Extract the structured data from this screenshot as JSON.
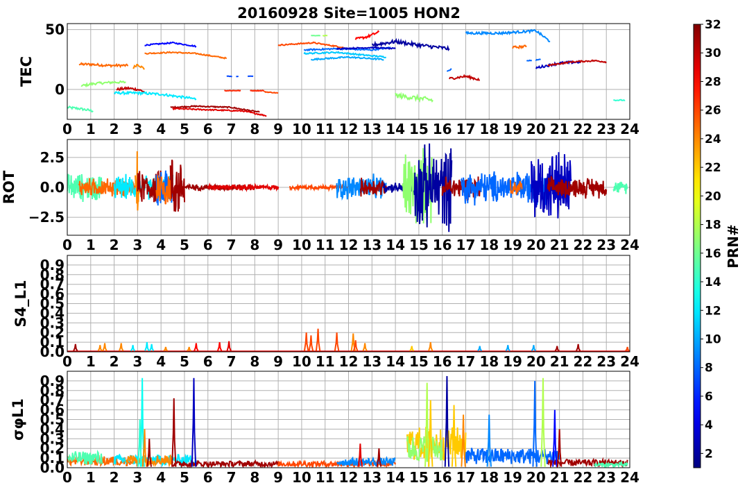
{
  "title": "20160928 Site=1005 HON2",
  "colorbar": {
    "label": "PRN#",
    "ticks": [
      "2",
      "4",
      "6",
      "8",
      "10",
      "12",
      "14",
      "16",
      "18",
      "20",
      "22",
      "24",
      "26",
      "28",
      "30",
      "32"
    ],
    "range": [
      1,
      32
    ],
    "colormap": "jet"
  },
  "chart_data": [
    {
      "type": "line",
      "panel": "tec",
      "ylabel": "TEC",
      "xlim": [
        0,
        24
      ],
      "ylim": [
        -25,
        55
      ],
      "xticks": [
        "0",
        "1",
        "2",
        "3",
        "4",
        "5",
        "6",
        "7",
        "8",
        "9",
        "10",
        "11",
        "12",
        "13",
        "14",
        "15",
        "16",
        "17",
        "18",
        "19",
        "20",
        "21",
        "22",
        "23",
        "24"
      ],
      "yticks": [
        "50",
        "0"
      ],
      "yticks_values": [
        50,
        0
      ],
      "grid": true,
      "series": [
        {
          "prn": 15,
          "x": [
            0.0,
            0.5,
            1.1
          ],
          "y": [
            -15,
            -16,
            -18
          ],
          "noise": 1
        },
        {
          "prn": 25,
          "x": [
            0.5,
            1.0,
            1.7,
            2.6
          ],
          "y": [
            21,
            21,
            20,
            20
          ],
          "noise": 1
        },
        {
          "prn": 17,
          "x": [
            0.6,
            1.2,
            2.0,
            2.5
          ],
          "y": [
            3,
            5,
            6,
            6
          ],
          "noise": 1
        },
        {
          "prn": 24,
          "x": [
            2.8,
            3.0,
            3.3
          ],
          "y": [
            18,
            21,
            17
          ],
          "noise": 1
        },
        {
          "prn": 30,
          "x": [
            2.1,
            2.6,
            3.0,
            3.3
          ],
          "y": [
            0,
            1,
            0,
            -2
          ],
          "noise": 1
        },
        {
          "prn": 12,
          "x": [
            2.0,
            3.0,
            4.0,
            5.5
          ],
          "y": [
            -3,
            -3,
            -4,
            -8
          ],
          "noise": 1
        },
        {
          "prn": 5,
          "x": [
            3.3,
            4.5,
            5.5
          ],
          "y": [
            37,
            39,
            36
          ],
          "noise": 0.5
        },
        {
          "prn": 25,
          "x": [
            3.3,
            4.5,
            5.5,
            6.8
          ],
          "y": [
            30,
            31,
            30,
            26
          ],
          "noise": 0.5
        },
        {
          "prn": 31,
          "x": [
            4.4,
            5.5,
            7.0,
            8.2
          ],
          "y": [
            -15,
            -14,
            -15,
            -19
          ],
          "noise": 0.5
        },
        {
          "prn": 29,
          "x": [
            4.5,
            6.0,
            7.5,
            8.5
          ],
          "y": [
            -16,
            -17,
            -18,
            -22
          ],
          "noise": 0.5
        },
        {
          "prn": 27,
          "x": [
            6.7,
            7.4
          ],
          "y": [
            -1,
            -1
          ],
          "noise": 0.3
        },
        {
          "prn": 27,
          "x": [
            7.8,
            8.4
          ],
          "y": [
            -1,
            -1
          ],
          "noise": 0.3
        },
        {
          "prn": 26,
          "x": [
            8.4,
            9.0
          ],
          "y": [
            -2,
            -3
          ],
          "noise": 0.3
        },
        {
          "prn": 7,
          "x": [
            6.8,
            7.3
          ],
          "y": [
            11,
            11
          ],
          "noise": 0.2,
          "dash": true
        },
        {
          "prn": 7,
          "x": [
            7.7,
            8.0
          ],
          "y": [
            11,
            11
          ],
          "noise": 0.2,
          "dash": true
        },
        {
          "prn": 26,
          "x": [
            9.0,
            10.5,
            11.8
          ],
          "y": [
            37,
            39,
            35
          ],
          "noise": 0.5
        },
        {
          "prn": 16,
          "x": [
            10.4,
            10.8
          ],
          "y": [
            45,
            45
          ],
          "noise": 0.2
        },
        {
          "prn": 18,
          "x": [
            10.9,
            11.1
          ],
          "y": [
            45,
            45
          ],
          "noise": 0.2
        },
        {
          "prn": 28,
          "x": [
            12.3,
            12.8,
            13.3
          ],
          "y": [
            42,
            44,
            48
          ],
          "noise": 1
        },
        {
          "prn": 8,
          "x": [
            10.1,
            11.5,
            13.0,
            13.8
          ],
          "y": [
            33,
            34,
            33,
            35
          ],
          "noise": 0.6
        },
        {
          "prn": 10,
          "x": [
            10.4,
            12.0,
            13.5
          ],
          "y": [
            25,
            27,
            25
          ],
          "noise": 0.6
        },
        {
          "prn": 11,
          "x": [
            10.1,
            11.5,
            12.5,
            13.6
          ],
          "y": [
            30,
            31,
            29,
            27
          ],
          "noise": 0.6
        },
        {
          "prn": 3,
          "x": [
            11.5,
            13.0,
            14.0
          ],
          "y": [
            34,
            35,
            34
          ],
          "noise": 0.5
        },
        {
          "prn": 2,
          "x": [
            13.0,
            14.0,
            15.0,
            16.3
          ],
          "y": [
            37,
            40,
            37,
            34
          ],
          "noise": 1.5
        },
        {
          "prn": 17,
          "x": [
            14.0,
            14.8,
            15.6
          ],
          "y": [
            -5,
            -7,
            -9
          ],
          "noise": 2
        },
        {
          "prn": 8,
          "x": [
            16.2,
            16.4
          ],
          "y": [
            15,
            17
          ],
          "noise": 0.5
        },
        {
          "prn": 30,
          "x": [
            16.3,
            17.0,
            17.6
          ],
          "y": [
            9,
            11,
            8
          ],
          "noise": 1
        },
        {
          "prn": 9,
          "x": [
            17.0,
            18.5,
            20.0,
            20.6
          ],
          "y": [
            47,
            47,
            49,
            40
          ],
          "noise": 1
        },
        {
          "prn": 25,
          "x": [
            19.0,
            19.6
          ],
          "y": [
            35,
            36
          ],
          "noise": 1
        },
        {
          "prn": 8,
          "x": [
            19.6,
            20.2
          ],
          "y": [
            24,
            25
          ],
          "noise": 0.3,
          "dash": true
        },
        {
          "prn": 3,
          "x": [
            20.0,
            21.0,
            21.9
          ],
          "y": [
            18,
            22,
            23
          ],
          "noise": 1
        },
        {
          "prn": 30,
          "x": [
            20.5,
            21.5,
            22.5,
            23.0
          ],
          "y": [
            20,
            23,
            24,
            23
          ],
          "noise": 0.6
        },
        {
          "prn": 14,
          "x": [
            23.3,
            23.8
          ],
          "y": [
            -9,
            -9
          ],
          "noise": 0.4
        }
      ]
    },
    {
      "type": "line",
      "panel": "rot",
      "ylabel": "ROT",
      "xlim": [
        0,
        24
      ],
      "ylim": [
        -4,
        4
      ],
      "xticks": [
        "0",
        "1",
        "2",
        "3",
        "4",
        "5",
        "6",
        "7",
        "8",
        "9",
        "10",
        "11",
        "12",
        "13",
        "14",
        "15",
        "16",
        "17",
        "18",
        "19",
        "20",
        "21",
        "22",
        "23",
        "24"
      ],
      "yticks": [
        "2.5",
        "0.0",
        "−2.5"
      ],
      "yticks_values": [
        2.5,
        0,
        -2.5
      ],
      "grid": true,
      "series": [
        {
          "prn": 15,
          "x": [
            0.0,
            1.5
          ],
          "amp": 1.4
        },
        {
          "prn": 25,
          "x": [
            0.5,
            3.0
          ],
          "amp": 0.9
        },
        {
          "prn": 12,
          "x": [
            2.0,
            4.5
          ],
          "amp": 1.2
        },
        {
          "prn": 24,
          "x": [
            2.9,
            3.1
          ],
          "amp": 3.5
        },
        {
          "prn": 31,
          "x": [
            3.0,
            4.0
          ],
          "amp": 1.6
        },
        {
          "prn": 8,
          "x": [
            3.8,
            4.5
          ],
          "amp": 2.2
        },
        {
          "prn": 25,
          "x": [
            3.8,
            4.4
          ],
          "amp": 2.0
        },
        {
          "prn": 31,
          "x": [
            4.4,
            5.0
          ],
          "amp": 3.2
        },
        {
          "prn": 31,
          "x": [
            5.0,
            8.0
          ],
          "amp": 0.3
        },
        {
          "prn": 29,
          "x": [
            6.0,
            9.0
          ],
          "amp": 0.25
        },
        {
          "prn": 26,
          "x": [
            9.5,
            12.0
          ],
          "amp": 0.2
        },
        {
          "prn": 9,
          "x": [
            11.5,
            13.6
          ],
          "amp": 1.2
        },
        {
          "prn": 31,
          "x": [
            12.5,
            13.6
          ],
          "amp": 0.9
        },
        {
          "prn": 2,
          "x": [
            13.5,
            15.0
          ],
          "amp": 0.5
        },
        {
          "prn": 17,
          "x": [
            14.3,
            15.6
          ],
          "amp": 3.8
        },
        {
          "prn": 2,
          "x": [
            14.8,
            16.4
          ],
          "amp": 4.0
        },
        {
          "prn": 31,
          "x": [
            16.0,
            17.6
          ],
          "amp": 1.2
        },
        {
          "prn": 8,
          "x": [
            16.8,
            20.5
          ],
          "amp": 1.6
        },
        {
          "prn": 25,
          "x": [
            18.9,
            19.4
          ],
          "amp": 0.8
        },
        {
          "prn": 3,
          "x": [
            19.8,
            21.5
          ],
          "amp": 3.5
        },
        {
          "prn": 31,
          "x": [
            20.5,
            23.0
          ],
          "amp": 1.0
        },
        {
          "prn": 15,
          "x": [
            23.3,
            23.9
          ],
          "amp": 0.6
        }
      ]
    },
    {
      "type": "line",
      "panel": "s4",
      "ylabel": "S4_L1",
      "xlim": [
        0,
        24
      ],
      "ylim": [
        0,
        1.0
      ],
      "xticks": [
        "0",
        "1",
        "2",
        "3",
        "4",
        "5",
        "6",
        "7",
        "8",
        "9",
        "10",
        "11",
        "12",
        "13",
        "14",
        "15",
        "16",
        "17",
        "18",
        "19",
        "20",
        "21",
        "22",
        "23",
        "24"
      ],
      "yticks": [
        "0.0",
        "0.1",
        "0.2",
        "0.3",
        "0.4",
        "0.5",
        "0.6",
        "0.7",
        "0.8",
        "0.9"
      ],
      "yticks_values": [
        0,
        0.1,
        0.2,
        0.3,
        0.4,
        0.5,
        0.6,
        0.7,
        0.8,
        0.9
      ],
      "grid": true,
      "spikes": [
        {
          "prn": 31,
          "x": 0.35,
          "h": 0.08
        },
        {
          "prn": 24,
          "x": 1.4,
          "h": 0.07
        },
        {
          "prn": 24,
          "x": 1.6,
          "h": 0.09
        },
        {
          "prn": 24,
          "x": 2.3,
          "h": 0.09
        },
        {
          "prn": 12,
          "x": 2.8,
          "h": 0.07
        },
        {
          "prn": 12,
          "x": 3.4,
          "h": 0.1
        },
        {
          "prn": 12,
          "x": 3.6,
          "h": 0.08
        },
        {
          "prn": 24,
          "x": 4.2,
          "h": 0.05
        },
        {
          "prn": 24,
          "x": 5.2,
          "h": 0.05
        },
        {
          "prn": 28,
          "x": 5.5,
          "h": 0.09
        },
        {
          "prn": 28,
          "x": 6.5,
          "h": 0.1
        },
        {
          "prn": 29,
          "x": 6.9,
          "h": 0.11
        },
        {
          "prn": 26,
          "x": 10.2,
          "h": 0.2
        },
        {
          "prn": 26,
          "x": 10.4,
          "h": 0.17
        },
        {
          "prn": 26,
          "x": 10.7,
          "h": 0.24
        },
        {
          "prn": 26,
          "x": 11.5,
          "h": 0.2
        },
        {
          "prn": 24,
          "x": 12.2,
          "h": 0.19
        },
        {
          "prn": 26,
          "x": 12.3,
          "h": 0.12
        },
        {
          "prn": 24,
          "x": 12.7,
          "h": 0.09
        },
        {
          "prn": 22,
          "x": 14.7,
          "h": 0.06
        },
        {
          "prn": 24,
          "x": 15.5,
          "h": 0.1
        },
        {
          "prn": 10,
          "x": 17.6,
          "h": 0.06
        },
        {
          "prn": 10,
          "x": 18.8,
          "h": 0.07
        },
        {
          "prn": 10,
          "x": 19.9,
          "h": 0.07
        },
        {
          "prn": 31,
          "x": 20.9,
          "h": 0.06
        },
        {
          "prn": 31,
          "x": 21.8,
          "h": 0.08
        },
        {
          "prn": 26,
          "x": 23.9,
          "h": 0.05
        }
      ]
    },
    {
      "type": "line",
      "panel": "sigma",
      "ylabel": "σφL1",
      "xlim": [
        0,
        24
      ],
      "ylim": [
        0,
        1.0
      ],
      "xticks": [
        "0",
        "1",
        "2",
        "3",
        "4",
        "5",
        "6",
        "7",
        "8",
        "9",
        "10",
        "11",
        "12",
        "13",
        "14",
        "15",
        "16",
        "17",
        "18",
        "19",
        "20",
        "21",
        "22",
        "23",
        "24"
      ],
      "yticks": [
        "0.0",
        "0.1",
        "0.2",
        "0.3",
        "0.4",
        "0.5",
        "0.6",
        "0.7",
        "0.8",
        "0.9"
      ],
      "yticks_values": [
        0,
        0.1,
        0.2,
        0.3,
        0.4,
        0.5,
        0.6,
        0.7,
        0.8,
        0.9
      ],
      "grid": true,
      "spikes": [
        {
          "prn": 13,
          "x": 3.2,
          "h": 0.93
        },
        {
          "prn": 14,
          "x": 3.1,
          "h": 0.5
        },
        {
          "prn": 24,
          "x": 3.3,
          "h": 0.4
        },
        {
          "prn": 31,
          "x": 3.5,
          "h": 0.3
        },
        {
          "prn": 31,
          "x": 4.55,
          "h": 0.72
        },
        {
          "prn": 3,
          "x": 5.4,
          "h": 0.93
        },
        {
          "prn": 29,
          "x": 12.5,
          "h": 0.25
        },
        {
          "prn": 31,
          "x": 13.3,
          "h": 0.2
        },
        {
          "prn": 18,
          "x": 15.35,
          "h": 0.88
        },
        {
          "prn": 22,
          "x": 15.5,
          "h": 0.7
        },
        {
          "prn": 2,
          "x": 16.2,
          "h": 0.95
        },
        {
          "prn": 22,
          "x": 16.5,
          "h": 0.65
        },
        {
          "prn": 24,
          "x": 16.9,
          "h": 0.55
        },
        {
          "prn": 9,
          "x": 18.0,
          "h": 0.55
        },
        {
          "prn": 8,
          "x": 19.95,
          "h": 0.9
        },
        {
          "prn": 18,
          "x": 20.3,
          "h": 0.93
        },
        {
          "prn": 5,
          "x": 20.8,
          "h": 0.6
        },
        {
          "prn": 31,
          "x": 21.0,
          "h": 0.4
        }
      ],
      "baseline": [
        {
          "prn": 25,
          "x": [
            0.0,
            3.0
          ],
          "level": 0.07
        },
        {
          "prn": 15,
          "x": [
            0.0,
            1.5
          ],
          "level": 0.1
        },
        {
          "prn": 12,
          "x": [
            2.0,
            5.5
          ],
          "level": 0.08
        },
        {
          "prn": 24,
          "x": [
            2.5,
            4.5
          ],
          "level": 0.08
        },
        {
          "prn": 31,
          "x": [
            4.5,
            9.0
          ],
          "level": 0.04
        },
        {
          "prn": 26,
          "x": [
            9.0,
            14.0
          ],
          "level": 0.04
        },
        {
          "prn": 9,
          "x": [
            11.5,
            14.0
          ],
          "level": 0.06
        },
        {
          "prn": 22,
          "x": [
            14.5,
            17.0
          ],
          "level": 0.25
        },
        {
          "prn": 17,
          "x": [
            14.5,
            16.0
          ],
          "level": 0.2
        },
        {
          "prn": 8,
          "x": [
            17.0,
            21.0
          ],
          "level": 0.12
        },
        {
          "prn": 31,
          "x": [
            20.5,
            23.9
          ],
          "level": 0.05
        },
        {
          "prn": 15,
          "x": [
            22.5,
            23.9
          ],
          "level": 0.03
        }
      ]
    }
  ]
}
